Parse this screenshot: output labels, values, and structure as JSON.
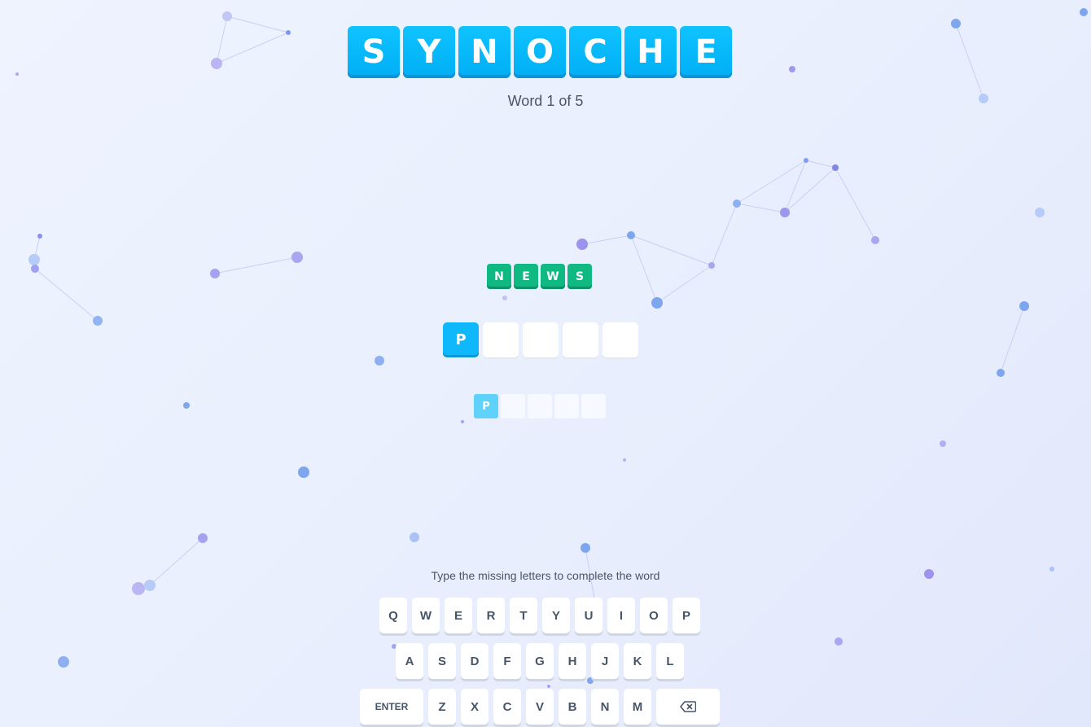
{
  "title": {
    "letters": [
      "S",
      "Y",
      "N",
      "O",
      "C",
      "H",
      "E"
    ]
  },
  "progress": {
    "text": "Word 1 of 5",
    "current": 1,
    "total": 5
  },
  "clue": {
    "letters": [
      "N",
      "E",
      "W",
      "S"
    ],
    "color": "#10b981"
  },
  "answer": {
    "letters": [
      "P",
      "",
      "",
      "",
      ""
    ],
    "filled_color": "#0fb8fb"
  },
  "preview": {
    "letters": [
      "P",
      "",
      "",
      "",
      ""
    ]
  },
  "hint": "Type the missing letters to complete the word",
  "keyboard": {
    "row1": [
      "Q",
      "W",
      "E",
      "R",
      "T",
      "Y",
      "U",
      "I",
      "O",
      "P"
    ],
    "row2": [
      "A",
      "S",
      "D",
      "F",
      "G",
      "H",
      "J",
      "K",
      "L"
    ],
    "row3": [
      "Z",
      "X",
      "C",
      "V",
      "B",
      "N",
      "M"
    ],
    "enter_label": "ENTER",
    "backspace_icon": "backspace-icon"
  },
  "colors": {
    "accent": "#00aef5",
    "clue": "#10b981",
    "key_text": "#475569"
  }
}
